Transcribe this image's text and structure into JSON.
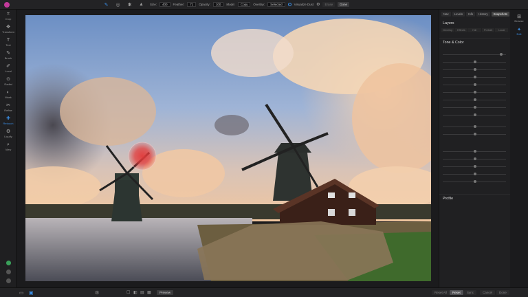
{
  "toolbar": {
    "size_label": "Size:",
    "size_value": "400",
    "feather_label": "Feather:",
    "feather_value": "71",
    "opacity_label": "Opacity:",
    "opacity_value": "100",
    "mode_label": "Mode:",
    "mode_value": "Copy",
    "overlay_label": "Overlay:",
    "overlay_value": "Selected",
    "visualize_label": "Visualize Dust",
    "erase_label": "Erase",
    "done_label": "Done"
  },
  "left_tools": [
    {
      "label": "Crop",
      "icon": "crop-icon",
      "glyph": "⌗"
    },
    {
      "label": "Transform",
      "icon": "transform-icon",
      "glyph": "✥"
    },
    {
      "label": "Text",
      "icon": "text-icon",
      "glyph": "T"
    },
    {
      "label": "Brush",
      "icon": "brush-icon",
      "glyph": "✎"
    },
    {
      "label": "Local",
      "icon": "local-icon",
      "glyph": "✐"
    },
    {
      "label": "Radial",
      "icon": "radial-icon",
      "glyph": "⊙"
    },
    {
      "label": "Mask",
      "icon": "mask-icon",
      "glyph": "◐"
    },
    {
      "label": "Refine",
      "icon": "refine-icon",
      "glyph": "✂"
    },
    {
      "label": "Retouch",
      "icon": "retouch-icon",
      "glyph": "✚"
    },
    {
      "label": "Liquify",
      "icon": "liquify-icon",
      "glyph": "⚙"
    },
    {
      "label": "View",
      "icon": "view-icon",
      "glyph": "⌕"
    }
  ],
  "panel": {
    "tabs": [
      "Nav",
      "Levels",
      "Info",
      "History",
      "Snapshots"
    ],
    "title": "Layers",
    "subtabs": [
      "Develop",
      "Effects",
      "Hdr",
      "Portrait",
      "Local"
    ],
    "section_title": "Tone & Color",
    "bottom_label": "Profile"
  },
  "right_strip": [
    {
      "label": "Browse",
      "icon": "browse-icon",
      "glyph": "⊞"
    },
    {
      "label": "Edit",
      "icon": "edit-icon",
      "glyph": "✦"
    }
  ],
  "bottom": {
    "preview_label": "Preview",
    "zoom_label": "Reset All",
    "reset_label": "Reset",
    "sync_label": "Sync",
    "cancel_label": "Cancel",
    "done_label": "Done"
  },
  "colors": {
    "accent": "#3a8fe8",
    "brush": "#e23a3a"
  }
}
